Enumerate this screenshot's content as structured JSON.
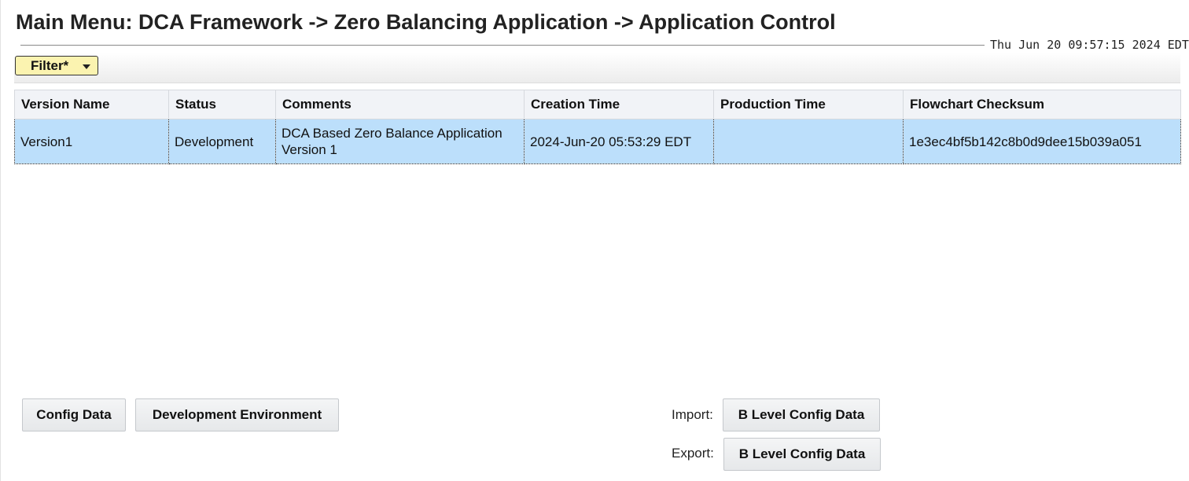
{
  "header": {
    "title": "Main Menu: DCA Framework -> Zero Balancing Application -> Application Control",
    "timestamp": "Thu Jun 20 09:57:15 2024 EDT"
  },
  "filter": {
    "label": "Filter*",
    "icon": "caret-down-icon"
  },
  "table": {
    "columns": [
      "Version Name",
      "Status",
      "Comments",
      "Creation Time",
      "Production Time",
      "Flowchart Checksum"
    ],
    "rows": [
      {
        "version_name": "Version1",
        "status": "Development",
        "comments": "DCA Based Zero Balance Application Version 1",
        "creation_time": "2024-Jun-20 05:53:29 EDT",
        "production_time": "",
        "flowchart_checksum": "1e3ec4bf5b142c8b0d9dee15b039a051"
      }
    ],
    "selected_row_color": "#bcdffb"
  },
  "actions": {
    "config_data": "Config Data",
    "development_environment": "Development Environment",
    "import_label": "Import:",
    "import_button": "B Level Config Data",
    "export_label": "Export:",
    "export_button": "B Level Config Data"
  }
}
